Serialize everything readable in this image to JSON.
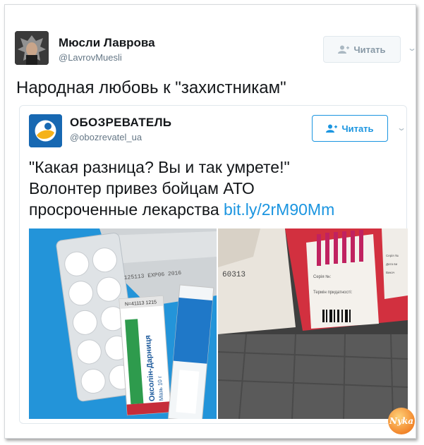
{
  "tweet": {
    "author_name": "Мюсли Лаврова",
    "author_handle": "@LavrovMuesli",
    "follow_label": "Читать",
    "text": "Народная любовь к \"захистникам\""
  },
  "quoted": {
    "author_name": "ОБОЗРЕВАТЕЛЬ",
    "author_handle": "@obozrevatel_ua",
    "follow_label": "Читать",
    "text_line1": "\"Какая разница? Вы и так умрете!\"",
    "text_line2": "Волонтер привез бойцам АТО",
    "text_line3": "просроченные лекарства",
    "link": "bit.ly/2rM90Mm",
    "photo_left": {
      "blister_label": "125113 EXP06 2016",
      "tube_brand": "Оксолін-Дарниця",
      "tube_sub": "Мазь 10 г",
      "tube_top": "N=41113 1215"
    },
    "photo_right": {
      "box_code": "60313",
      "serial_label": "Серія №:",
      "expiry_label": "Термін придатності:",
      "side_label1": "Серія №",
      "side_label2": "Дата ви",
      "side_label3": "Викоч"
    }
  },
  "watermark": "Nyka",
  "colors": {
    "link": "#1b95e0",
    "handle": "#657786",
    "quote_border": "#e1e8ed"
  }
}
